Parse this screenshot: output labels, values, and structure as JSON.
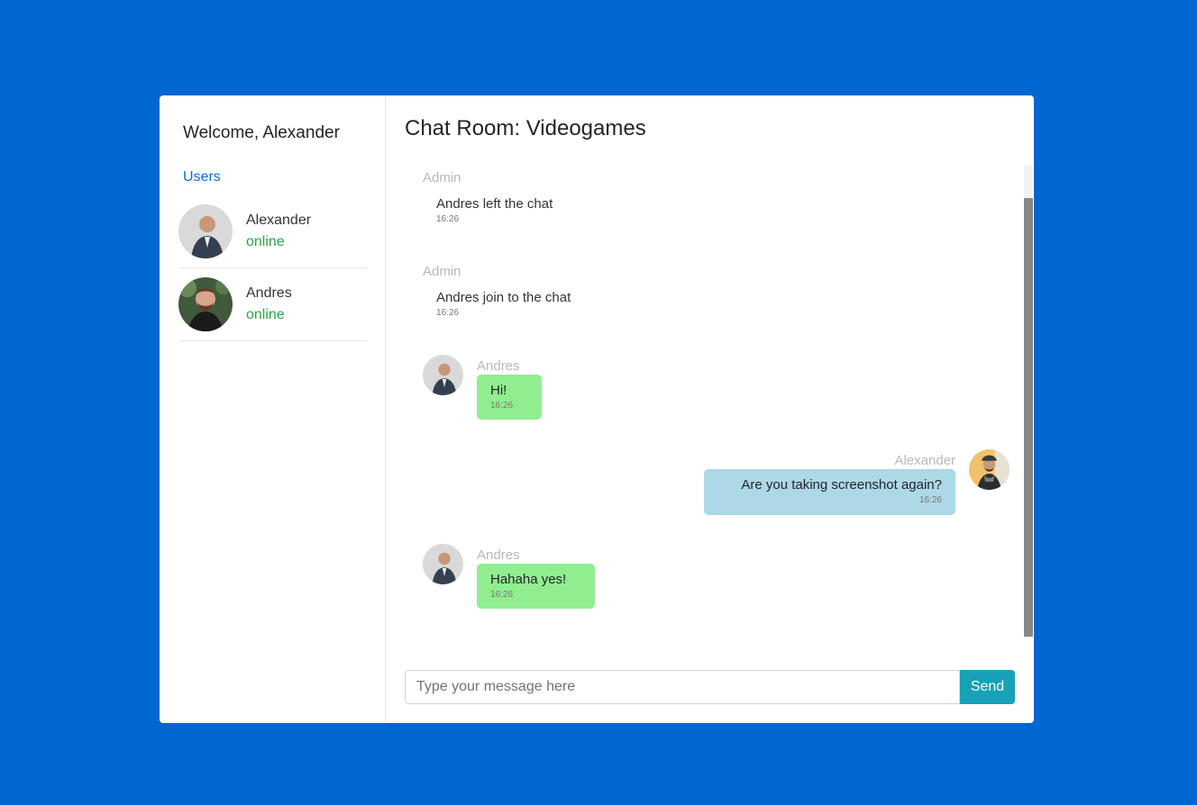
{
  "sidebar": {
    "welcome": "Welcome, Alexander",
    "users_label": "Users",
    "users": [
      {
        "name": "Alexander",
        "status": "online"
      },
      {
        "name": "Andres",
        "status": "online"
      }
    ]
  },
  "room": {
    "title": "Chat Room: Videogames"
  },
  "messages": [
    {
      "sender": "Admin",
      "text": "Andres left the chat",
      "time": "16:26",
      "kind": "system"
    },
    {
      "sender": "Admin",
      "text": "Andres join to the chat",
      "time": "16:26",
      "kind": "system"
    },
    {
      "sender": "Andres",
      "text": "Hi!",
      "time": "16:26",
      "kind": "incoming"
    },
    {
      "sender": "Alexander",
      "text": "Are you taking screenshot again?",
      "time": "16:26",
      "kind": "outgoing"
    },
    {
      "sender": "Andres",
      "text": "Hahaha yes!",
      "time": "16:26",
      "kind": "incoming"
    }
  ],
  "composer": {
    "placeholder": "Type your message here",
    "send_label": "Send"
  },
  "colors": {
    "background": "#0066d1",
    "incoming_bubble": "#90ee90",
    "outgoing_bubble": "#add8e6",
    "online": "#28a745",
    "send_button": "#17a2b8"
  }
}
